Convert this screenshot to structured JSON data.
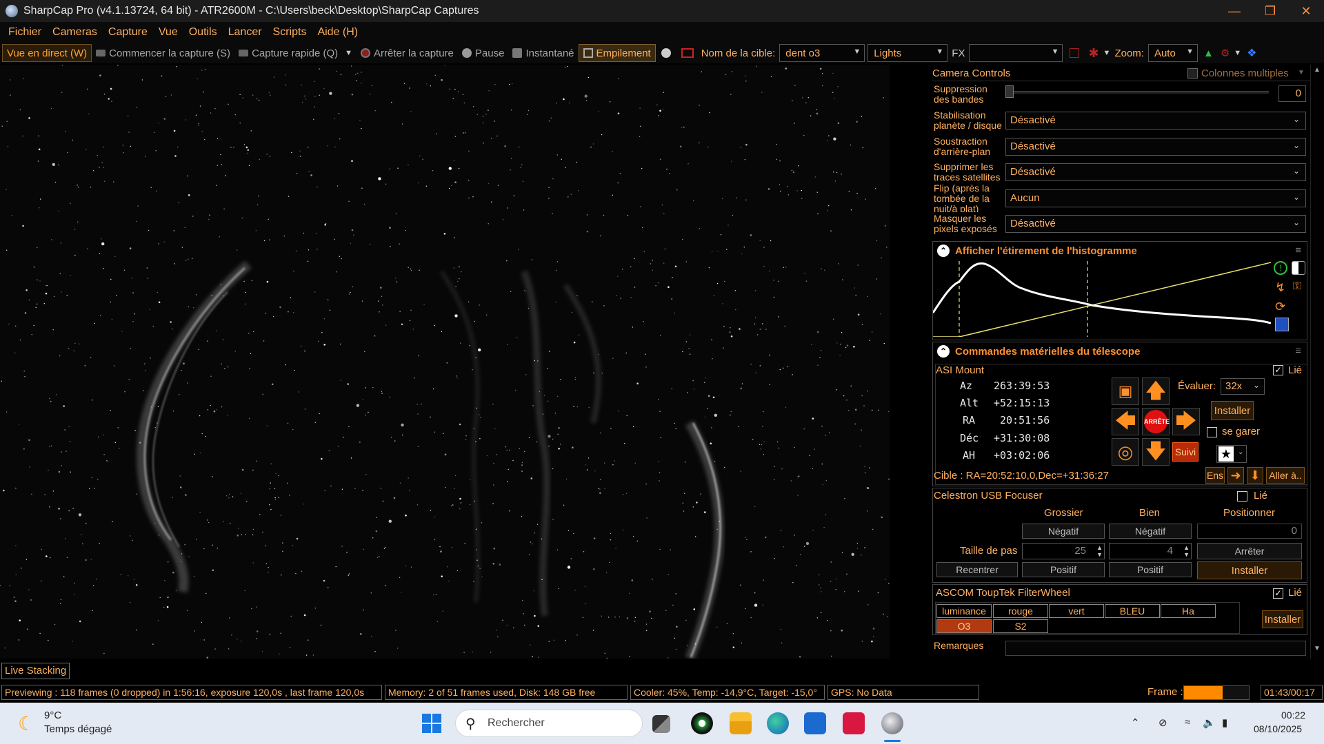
{
  "titlebar": {
    "title": "SharpCap Pro (v4.1.13724, 64 bit) - ATR2600M - C:\\Users\\beck\\Desktop\\SharpCap Captures"
  },
  "menu": [
    "Fichier",
    "Cameras",
    "Capture",
    "Vue",
    "Outils",
    "Lancer",
    "Scripts",
    "Aide (H)"
  ],
  "toolbar": {
    "live": "Vue en direct (W)",
    "start_capture": "Commencer la capture (S)",
    "quick_capture": "Capture rapide (Q)",
    "stop_capture": "Arrêter la capture",
    "pause": "Pause",
    "snapshot": "Instantané",
    "stacking": "Empilement",
    "target_label": "Nom de la cible:",
    "target_value": "dent o3",
    "frame_type": "Lights",
    "fx_label": "FX",
    "fx_value": "",
    "zoom_label": "Zoom:",
    "zoom_value": "Auto"
  },
  "camera_controls": {
    "title": "Camera Controls",
    "multi_columns": "Colonnes multiples",
    "banding_label": "Suppression des bandes",
    "banding_value": "0",
    "rows": [
      {
        "label": "Stabilisation planète / disque",
        "value": "Désactivé"
      },
      {
        "label": "Soustraction d'arrière-plan",
        "value": "Désactivé"
      },
      {
        "label": "Supprimer les traces satellites",
        "value": "Désactivé"
      },
      {
        "label": "Flip (après la tombée de la nuit/à plat)",
        "value": "Aucun"
      },
      {
        "label": "Masquer les pixels exposés",
        "value": "Désactivé"
      }
    ]
  },
  "histogram": {
    "title": "Afficher l'étirement de l'histogramme"
  },
  "telescope": {
    "title": "Commandes matérielles du télescope",
    "mount": "ASI Mount",
    "linked": "Lié",
    "coords": [
      {
        "k": "Az",
        "v": "263:39:53"
      },
      {
        "k": "Alt",
        "v": "+52:15:13"
      },
      {
        "k": "RA",
        "v": "20:51:56"
      },
      {
        "k": "Déc",
        "v": "+31:30:08"
      },
      {
        "k": "AH",
        "v": "+03:02:06"
      }
    ],
    "stop": "ARRÊTE",
    "evaluate_label": "Évaluer:",
    "evaluate_value": "32x",
    "install": "Installer",
    "park": "se garer",
    "track": "Suivi",
    "target": "Cible : RA=20:52:10,0,Dec=+31:36:27",
    "set_btn": "Ens",
    "goto": "Aller à.."
  },
  "focuser": {
    "name": "Celestron USB Focuser",
    "linked": "Lié",
    "col_coarse": "Grossier",
    "col_fine": "Bien",
    "col_position": "Positionner",
    "neg": "Négatif",
    "pos": "Positif",
    "position_value": "0",
    "step_label": "Taille de pas",
    "step_coarse": "25",
    "step_fine": "4",
    "stop": "Arrêter",
    "recenter": "Recentrer",
    "install": "Installer"
  },
  "filterwheel": {
    "name": "ASCOM ToupTek FilterWheel",
    "linked": "Lié",
    "filters": [
      "luminance",
      "rouge",
      "vert",
      "BLEU",
      "Ha",
      "O3",
      "S2"
    ],
    "selected": "O3",
    "install": "Installer"
  },
  "remarks": "Remarques",
  "live_stacking_tab": "Live Stacking",
  "status": {
    "preview": "Previewing : 118 frames (0 dropped) in 1:56:16, exposure 120,0s , last frame 120,0s",
    "memory": "Memory: 2 of 51 frames used, Disk: 148 GB free",
    "cooler": "Cooler: 45%, Temp: -14,9°C, Target: -15,0°",
    "gps": "GPS: No Data",
    "frame_label": "Frame :",
    "frame_progress": 0.6,
    "frame_time": "01:43/00:17"
  },
  "taskbar": {
    "weather_temp": "9°C",
    "weather_desc": "Temps dégagé",
    "search": "Rechercher",
    "time": "00:22",
    "date": "08/10/2025"
  },
  "colors": {
    "accent": "#ffb060",
    "orange": "#ff9030",
    "selected_filter": "#b23a10"
  }
}
